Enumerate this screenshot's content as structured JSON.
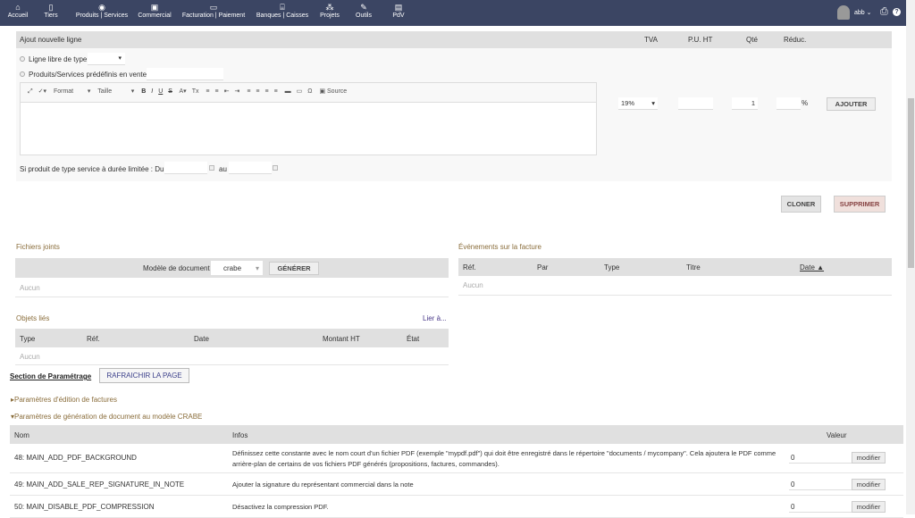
{
  "nav": {
    "items": [
      {
        "label": "Accueil",
        "icon": "home-icon",
        "glyph": "⌂"
      },
      {
        "label": "Tiers",
        "icon": "building-icon",
        "glyph": "▯"
      },
      {
        "label": "Produits | Services",
        "icon": "cube-icon",
        "glyph": "◉"
      },
      {
        "label": "Commercial",
        "icon": "briefcase-icon",
        "glyph": "▣"
      },
      {
        "label": "Facturation | Paiement",
        "icon": "money-icon",
        "glyph": "▭"
      },
      {
        "label": "Banques | Caisses",
        "icon": "bank-icon",
        "glyph": "⌸"
      },
      {
        "label": "Projets",
        "icon": "sitemap-icon",
        "glyph": "⁂"
      },
      {
        "label": "Outils",
        "icon": "wrench-icon",
        "glyph": "✎"
      },
      {
        "label": "PdV",
        "icon": "cash-register-icon",
        "glyph": "▤"
      }
    ],
    "user": "abb",
    "print_icon": "printer-icon",
    "help_icon": "help-icon"
  },
  "addline": {
    "header": "Ajout nouvelle ligne",
    "cols": [
      "TVA",
      "P.U. HT",
      "Qté",
      "Réduc."
    ],
    "free_line": "Ligne libre de type",
    "predefined": "Produits/Services prédéfinis en vente",
    "toolbar": {
      "format": "Format",
      "size": "Taille",
      "source": "Source"
    },
    "tva": "19%",
    "qty": "1",
    "percent": "%",
    "add": "AJOUTER",
    "service_label": "Si produit de type service à durée limitée : Du",
    "to": "au"
  },
  "actions": {
    "clone": "CLONER",
    "delete": "SUPPRIMER"
  },
  "files": {
    "title": "Fichiers joints",
    "model_label": "Modèle de document",
    "model": "crabe",
    "generate": "GÉNÉRER",
    "none": "Aucun"
  },
  "events": {
    "title": "Événements sur la facture",
    "cols": [
      "Réf.",
      "Par",
      "Type",
      "Titre",
      "Date ▲"
    ],
    "none": "Aucun"
  },
  "linked": {
    "title": "Objets liés",
    "link": "Lier à...",
    "cols": [
      "Type",
      "Réf.",
      "Date",
      "Montant HT",
      "État"
    ],
    "none": "Aucun"
  },
  "params": {
    "section": "Section de Paramétrage",
    "refresh": "RAFRAICHIR LA PAGE",
    "group1": "Paramètres d'édition de factures",
    "group2": "Paramètres de génération de document au modèle CRABE",
    "cols": [
      "Nom",
      "Infos",
      "Valeur"
    ],
    "modify": "modifier",
    "rows": [
      {
        "name": "48: MAIN_ADD_PDF_BACKGROUND",
        "info": "Définissez cette constante avec le nom court d'un fichier PDF (exemple \"mypdf.pdf\") qui doit être enregistré dans le répertoire \"documents / mycompany\". Cela ajoutera le PDF comme arrière-plan de certains de vos fichiers PDF générés (propositions, factures, commandes).",
        "value": "0"
      },
      {
        "name": "49: MAIN_ADD_SALE_REP_SIGNATURE_IN_NOTE",
        "info": "Ajouter la signature du représentant commercial dans la note",
        "value": "0"
      },
      {
        "name": "50: MAIN_DISABLE_PDF_COMPRESSION",
        "info": "Désactivez la compression PDF.",
        "value": "0"
      }
    ]
  }
}
